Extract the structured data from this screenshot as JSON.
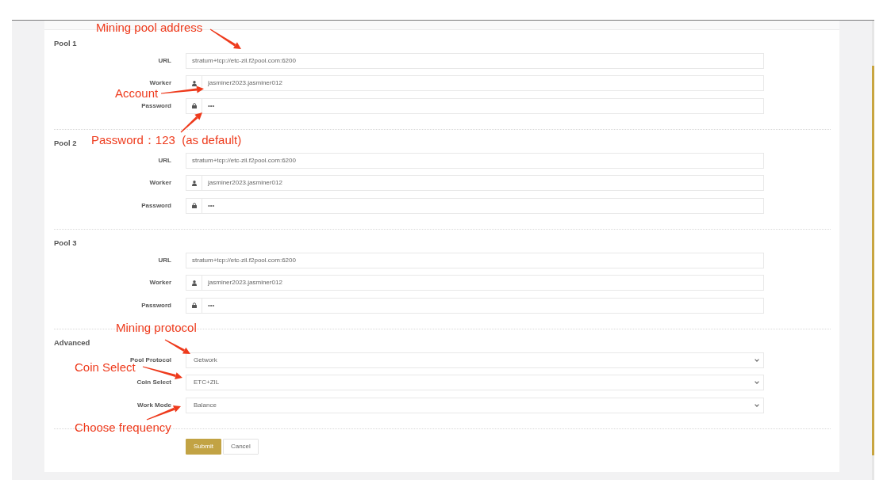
{
  "pools": [
    {
      "title": "Pool 1",
      "fields": [
        {
          "kind": "url",
          "label": "URL",
          "value": "stratum+tcp://etc-zil.f2pool.com:6200"
        },
        {
          "kind": "worker",
          "label": "Worker",
          "value": "jasminer2023.jasminer012"
        },
        {
          "kind": "password",
          "label": "Password",
          "value": "•••"
        }
      ]
    },
    {
      "title": "Pool 2",
      "fields": [
        {
          "kind": "url",
          "label": "URL",
          "value": "stratum+tcp://etc-zil.f2pool.com:6200"
        },
        {
          "kind": "worker",
          "label": "Worker",
          "value": "jasminer2023.jasminer012"
        },
        {
          "kind": "password",
          "label": "Password",
          "value": "•••"
        }
      ]
    },
    {
      "title": "Pool 3",
      "fields": [
        {
          "kind": "url",
          "label": "URL",
          "value": "stratum+tcp://etc-zil.f2pool.com:6200"
        },
        {
          "kind": "worker",
          "label": "Worker",
          "value": "jasminer2023.jasminer012"
        },
        {
          "kind": "password",
          "label": "Password",
          "value": "•••"
        }
      ]
    }
  ],
  "advanced": {
    "title": "Advanced",
    "fields": [
      {
        "kind": "select",
        "label": "Pool Protocol",
        "value": "Getwork"
      },
      {
        "kind": "select",
        "label": "Coin Select",
        "value": "ETC+ZIL"
      },
      {
        "kind": "select",
        "label": "Work Mode",
        "value": "Balance"
      }
    ]
  },
  "buttons": [
    {
      "kind": "primary",
      "label": "Submit"
    },
    {
      "kind": "secondary",
      "label": "Cancel"
    }
  ],
  "annotations": [
    "Mining pool address",
    "Account",
    "Password：123  (as default)",
    "Mining protocol",
    "Coin Select",
    "Choose frequency"
  ]
}
